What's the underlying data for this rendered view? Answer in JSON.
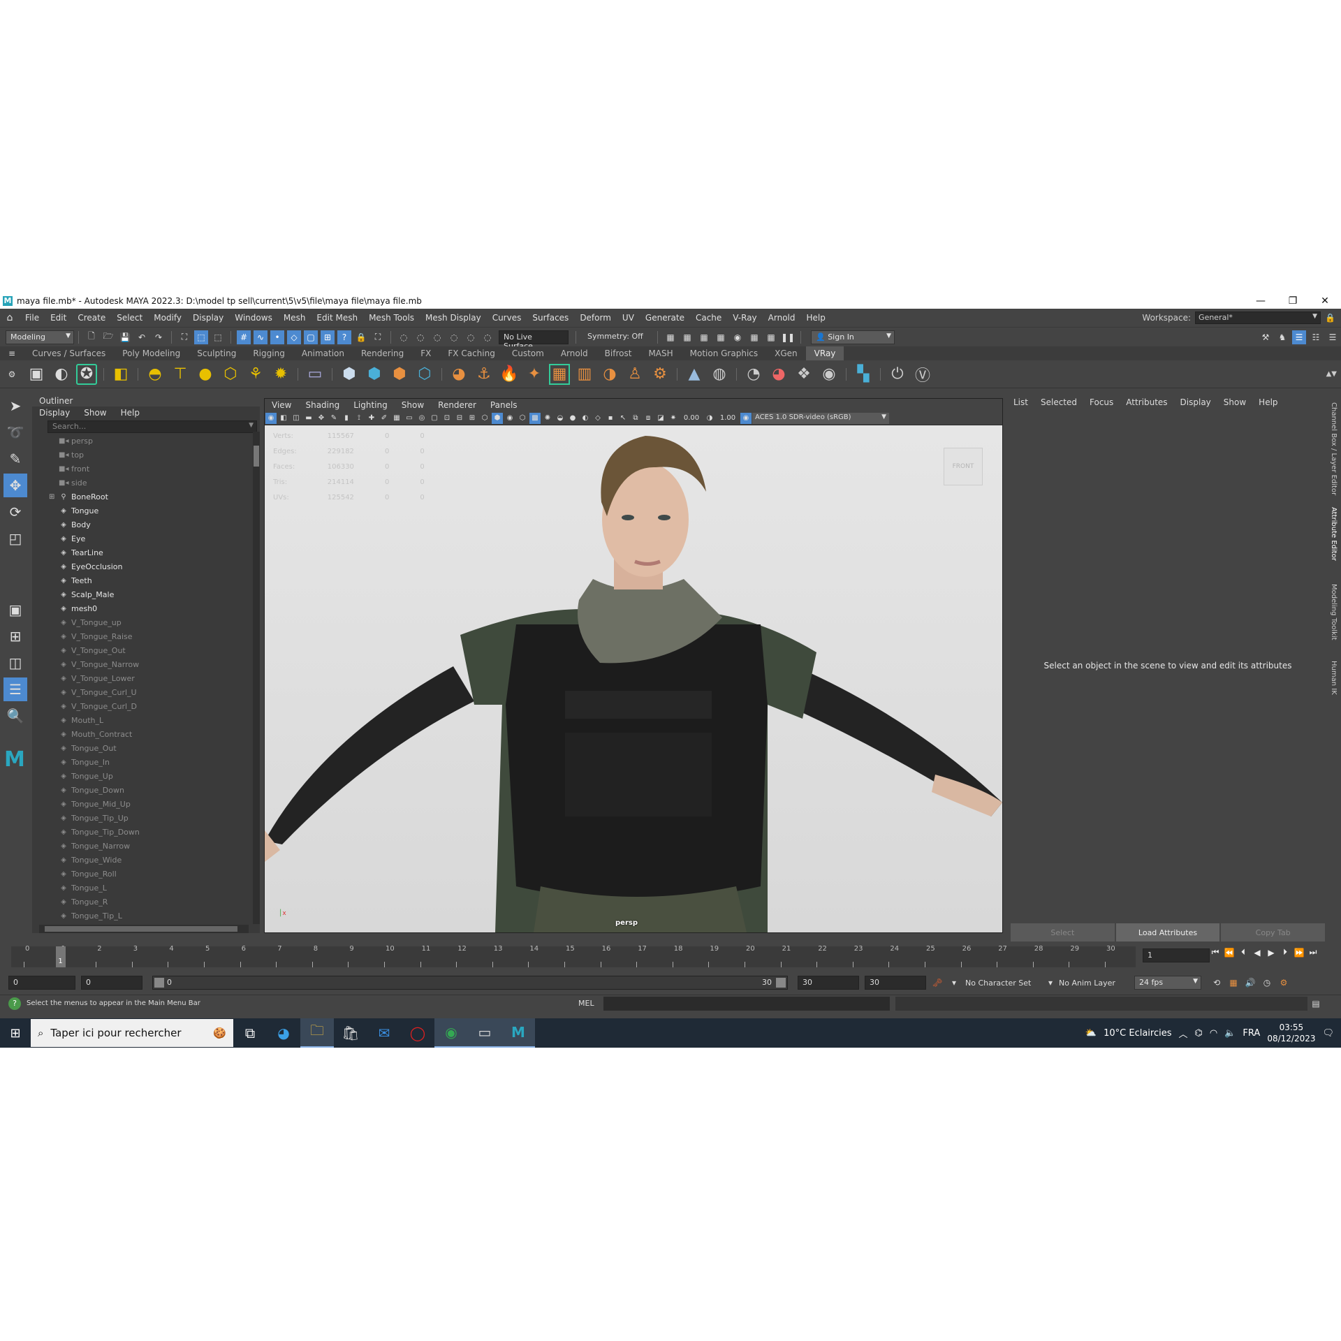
{
  "window": {
    "title": "maya file.mb* - Autodesk MAYA 2022.3: D:\\model tp sell\\current\\5\\v5\\file\\maya file\\maya file.mb",
    "logo": "M"
  },
  "menubar": {
    "items": [
      "File",
      "Edit",
      "Create",
      "Select",
      "Modify",
      "Display",
      "Windows",
      "Mesh",
      "Edit Mesh",
      "Mesh Tools",
      "Mesh Display",
      "Curves",
      "Surfaces",
      "Deform",
      "UV",
      "Generate",
      "Cache",
      "V-Ray",
      "Arnold",
      "Help"
    ],
    "workspace_label": "Workspace:",
    "workspace_value": "General*"
  },
  "statusline": {
    "mode": "Modeling",
    "live_surface": "No Live Surface",
    "symmetry": "Symmetry: Off",
    "sign_in": "Sign In"
  },
  "shelf": {
    "tabs": [
      "Curves / Surfaces",
      "Poly Modeling",
      "Sculpting",
      "Rigging",
      "Animation",
      "Rendering",
      "FX",
      "FX Caching",
      "Custom",
      "Arnold",
      "Bifrost",
      "MASH",
      "Motion Graphics",
      "XGen",
      "VRay"
    ],
    "active_tab": "VRay"
  },
  "outliner": {
    "title": "Outliner",
    "menu": [
      "Display",
      "Show",
      "Help"
    ],
    "search_placeholder": "Search...",
    "cameras": [
      "persp",
      "top",
      "front",
      "side"
    ],
    "root": "BoneRoot",
    "meshes": [
      "Tongue",
      "Body",
      "Eye",
      "TearLine",
      "EyeOcclusion",
      "Teeth",
      "Scalp_Male",
      "mesh0"
    ],
    "blendshapes": [
      "V_Tongue_up",
      "V_Tongue_Raise",
      "V_Tongue_Out",
      "V_Tongue_Narrow",
      "V_Tongue_Lower",
      "V_Tongue_Curl_U",
      "V_Tongue_Curl_D",
      "Mouth_L",
      "Mouth_Contract",
      "Tongue_Out",
      "Tongue_In",
      "Tongue_Up",
      "Tongue_Down",
      "Tongue_Mid_Up",
      "Tongue_Tip_Up",
      "Tongue_Tip_Down",
      "Tongue_Narrow",
      "Tongue_Wide",
      "Tongue_Roll",
      "Tongue_L",
      "Tongue_R",
      "Tongue_Tip_L"
    ]
  },
  "viewport": {
    "menu": [
      "View",
      "Shading",
      "Lighting",
      "Show",
      "Renderer",
      "Panels"
    ],
    "exposure": "0.00",
    "gamma": "1.00",
    "color_space": "ACES 1.0 SDR-video (sRGB)",
    "hud": [
      {
        "label": "Verts:",
        "a": "115567",
        "b": "0",
        "c": "0"
      },
      {
        "label": "Edges:",
        "a": "229182",
        "b": "0",
        "c": "0"
      },
      {
        "label": "Faces:",
        "a": "106330",
        "b": "0",
        "c": "0"
      },
      {
        "label": "Tris:",
        "a": "214114",
        "b": "0",
        "c": "0"
      },
      {
        "label": "UVs:",
        "a": "125542",
        "b": "0",
        "c": "0"
      }
    ],
    "viewcube_label": "FRONT",
    "camera_label": "persp"
  },
  "attribute_editor": {
    "menu": [
      "List",
      "Selected",
      "Focus",
      "Attributes",
      "Display",
      "Show",
      "Help"
    ],
    "message": "Select an object in the scene to view and edit its attributes",
    "buttons": [
      "Select",
      "Load Attributes",
      "Copy Tab"
    ]
  },
  "side_tabs": [
    "Channel Box / Layer Editor",
    "Attribute Editor",
    "Modeling Toolkit",
    "Human IK"
  ],
  "timeline": {
    "ticks": [
      "0",
      "1",
      "2",
      "3",
      "4",
      "5",
      "6",
      "7",
      "8",
      "9",
      "10",
      "11",
      "12",
      "13",
      "14",
      "15",
      "16",
      "17",
      "18",
      "19",
      "20",
      "21",
      "22",
      "23",
      "24",
      "25",
      "26",
      "27",
      "28",
      "29",
      "30"
    ],
    "current_frame": "1",
    "frame_field": "1"
  },
  "range": {
    "start": "0",
    "anim_start": "0",
    "bar_start": "0",
    "bar_end": "30",
    "end": "30",
    "anim_end": "30",
    "character_set": "No Character Set",
    "anim_layer": "No Anim Layer",
    "fps": "24 fps"
  },
  "cmdline": {
    "help": "Select the menus to appear in the Main Menu Bar",
    "lang": "MEL"
  },
  "taskbar": {
    "search_placeholder": "Taper ici pour rechercher",
    "weather": "10°C  Eclaircies",
    "language": "FRA",
    "time": "03:55",
    "date": "08/12/2023"
  }
}
